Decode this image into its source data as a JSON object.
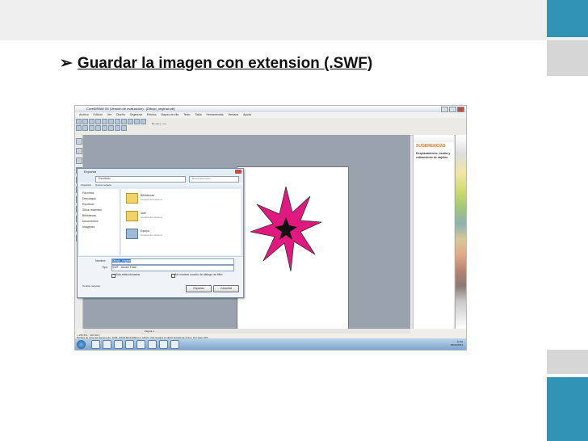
{
  "slide": {
    "bullet_marker": "➢",
    "heading": "Guardar la imagen con extension (.SWF)"
  },
  "app": {
    "title": "CorelDRAW X5 (Versión de evaluación) - [Dibujo_original.cdr]",
    "menus": [
      "Archivo",
      "Edición",
      "Ver",
      "Diseño",
      "Organizar",
      "Efectos",
      "Mapas de bits",
      "Texto",
      "Tabla",
      "Herramientas",
      "Ventana",
      "Ayuda"
    ],
    "zoom": "Prueba con",
    "page_tab": "Página 1"
  },
  "docker": {
    "title": "SUGERENCIAS",
    "subtitle": "Desplazamiento, escala y estiramiento de objetos"
  },
  "star": {
    "fill": "#e0187f",
    "stroke": "#333333",
    "center": "#111111"
  },
  "dialog": {
    "title": "Exportar",
    "path": "Escritorio",
    "search_placeholder": "Buscar Escritorio",
    "organize": "Organizar",
    "new_folder": "Nueva carpeta",
    "nav": [
      "Favoritos",
      "Descargas",
      "Escritorio",
      "Sitios recientes",
      "Bibliotecas",
      "Documentos",
      "Imágenes"
    ],
    "files": [
      {
        "name": "Bibliotecas",
        "desc": "Carpeta del sistema"
      },
      {
        "name": "user",
        "desc": "Carpeta del sistema"
      },
      {
        "name": "Equipo",
        "desc": "Carpeta del sistema"
      }
    ],
    "filename_label": "Nombre:",
    "filename_value": "Dibujo_original",
    "type_label": "Tipo:",
    "type_value": "SWF - Adobe Flash",
    "only_selected": "Sólo seleccionados",
    "no_filter": "No mostrar cuadro de diálogo de filtro",
    "export_button": "Exportar",
    "cancel_button": "Cancelar",
    "hide_folders": "Ocultar carpetas"
  },
  "status": {
    "coords": "( -295,551 ; 326,600 )",
    "profiles": "Perfiles de color del documento: RGB: sRGB IEC61966-2.1; CMYK: ISO Coated v2 (ECI); Escala de grises: Dot Gain 15%"
  },
  "taskbar": {
    "time": "12:22",
    "date": "05/02/2013"
  }
}
